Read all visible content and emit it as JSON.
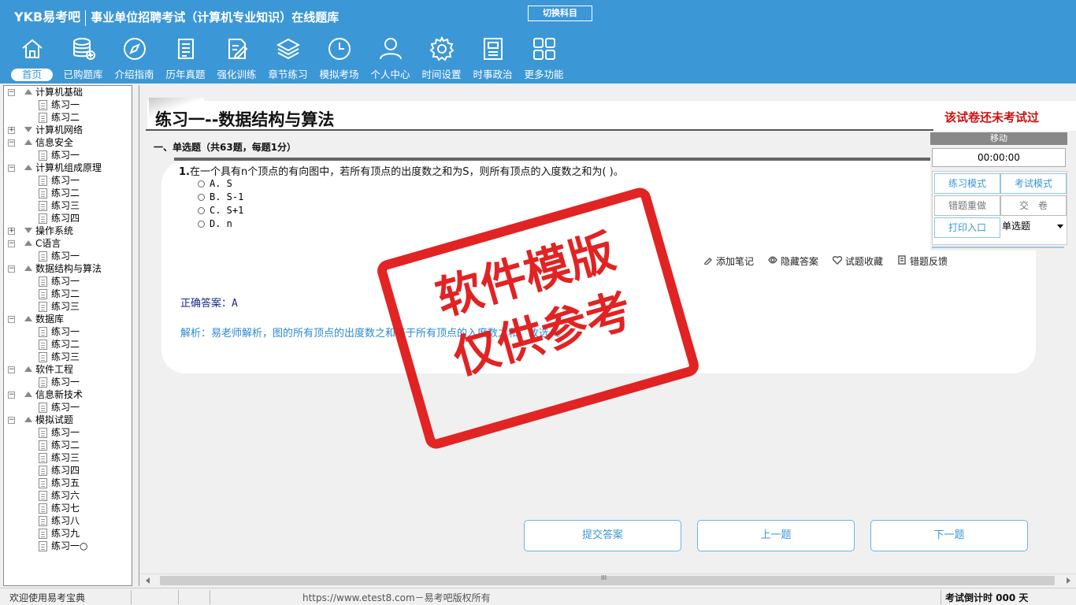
{
  "app": {
    "logo": "YKB易考吧",
    "title": "事业单位招聘考试（计算机专业知识）在线题库",
    "switch_subject": "切换科目"
  },
  "nav": [
    {
      "label": "首页",
      "icon": "home-icon",
      "active": true
    },
    {
      "label": "已购题库",
      "icon": "database-icon"
    },
    {
      "label": "介绍指南",
      "icon": "compass-icon"
    },
    {
      "label": "历年真题",
      "icon": "document-list-icon"
    },
    {
      "label": "强化训练",
      "icon": "edit-icon"
    },
    {
      "label": "章节练习",
      "icon": "layers-icon"
    },
    {
      "label": "模拟考场",
      "icon": "clock-icon"
    },
    {
      "label": "个人中心",
      "icon": "user-icon"
    },
    {
      "label": "时间设置",
      "icon": "gear-icon"
    },
    {
      "label": "时事政治",
      "icon": "newspaper-icon"
    },
    {
      "label": "更多功能",
      "icon": "grid-icon"
    }
  ],
  "tree": [
    {
      "label": "计算机基础",
      "expanded": true,
      "children": [
        "练习一",
        "练习二"
      ]
    },
    {
      "label": "计算机网络",
      "expanded": false,
      "children": []
    },
    {
      "label": "信息安全",
      "expanded": true,
      "children": [
        "练习一"
      ]
    },
    {
      "label": "计算机组成原理",
      "expanded": true,
      "children": [
        "练习一",
        "练习二",
        "练习三",
        "练习四"
      ]
    },
    {
      "label": "操作系统",
      "expanded": false,
      "children": []
    },
    {
      "label": "C语言",
      "expanded": true,
      "children": [
        "练习一"
      ]
    },
    {
      "label": "数据结构与算法",
      "expanded": true,
      "children": [
        "练习一",
        "练习二",
        "练习三"
      ]
    },
    {
      "label": "数据库",
      "expanded": true,
      "children": [
        "练习一",
        "练习二",
        "练习三"
      ]
    },
    {
      "label": "软件工程",
      "expanded": true,
      "children": [
        "练习一"
      ]
    },
    {
      "label": "信息新技术",
      "expanded": true,
      "children": [
        "练习一"
      ]
    },
    {
      "label": "模拟试题",
      "expanded": true,
      "children": [
        "练习一",
        "练习二",
        "练习三",
        "练习四",
        "练习五",
        "练习六",
        "练习七",
        "练习八",
        "练习九",
        "练习一○"
      ]
    }
  ],
  "paper": {
    "title": "练习一--数据结构与算法",
    "status": "该试卷还未考试过",
    "section": "一、单选题（共63题，每题1分）"
  },
  "question": {
    "number": "1.",
    "text": "在一个具有n个顶点的有向图中，若所有顶点的出度数之和为S，则所有顶点的入度数之和为( )。",
    "options": [
      "A. S",
      "B. S-1",
      "C. S+1",
      "D. n"
    ],
    "answer_label": "正确答案：",
    "answer_value": "A",
    "analysis": "解析：易老师解析，图的所有顶点的出度数之和等于所有顶点的入度数之和，故选A。"
  },
  "tools": [
    {
      "label": "添加笔记",
      "icon": "pencil-icon"
    },
    {
      "label": "隐藏答案",
      "icon": "eye-icon"
    },
    {
      "label": "试题收藏",
      "icon": "heart-icon"
    },
    {
      "label": "错题反馈",
      "icon": "feedback-icon"
    }
  ],
  "stamp": {
    "line1": "软件模版",
    "line2": "仅供参考"
  },
  "panel": {
    "move": "移动",
    "timer": "00:00:00",
    "practice_mode": "练习模式",
    "exam_mode": "考试模式",
    "redo_wrong": "错题重做",
    "submit_paper": "交　卷",
    "print": "打印入口",
    "question_type": "单选题"
  },
  "buttons": {
    "submit": "提交答案",
    "prev": "上一题",
    "next": "下一题"
  },
  "statusbar": {
    "welcome": "欢迎使用易考宝典",
    "copyright": "https://www.etest8.com－易考吧版权所有",
    "countdown": "考试倒计时 000 天"
  }
}
